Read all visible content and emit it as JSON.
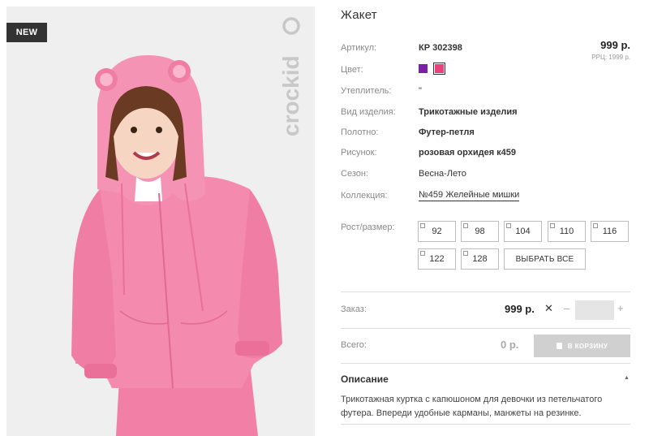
{
  "badge": "NEW",
  "brand": "crockid",
  "product": {
    "title": "Жакет",
    "price": "999 р.",
    "rrc": "РРЦ: 1999 р."
  },
  "details": [
    {
      "label": "Артикул:",
      "value": "КР 302398"
    },
    {
      "label": "Цвет:",
      "value": ""
    },
    {
      "label": "Утеплитель:",
      "value": "\""
    },
    {
      "label": "Вид изделия:",
      "value": "Трикотажные изделия"
    },
    {
      "label": "Полотно:",
      "value": "Футер-петля"
    },
    {
      "label": "Рисунок:",
      "value": "розовая орхидея к459"
    },
    {
      "label": "Сезон:",
      "value": "Весна-Лето"
    },
    {
      "label": "Коллекция:",
      "value": "№459 Желейные мишки"
    }
  ],
  "colors": [
    {
      "name": "purple",
      "hex": "#7a1fa6"
    },
    {
      "name": "pink",
      "hex": "#ec3f7c",
      "selected": true
    }
  ],
  "sizes": {
    "label": "Рост/размер:",
    "items": [
      "92",
      "98",
      "104",
      "110",
      "116",
      "122",
      "128"
    ],
    "select_all": "ВЫБРАТЬ ВСЕ"
  },
  "order": {
    "label": "Заказ:",
    "price": "999 р.",
    "times": "✕",
    "minus": "–",
    "plus": "+",
    "qty": ""
  },
  "total": {
    "label": "Всего:",
    "value": "0 р.",
    "cart_button": "В КОРЗИНУ"
  },
  "description": {
    "title": "Описание",
    "toggle": "▲",
    "text": "Трикотажная куртка с капюшоном для девочки из петельчатого футера. Впереди удобные карманы, манжеты на резинке."
  },
  "accent_colors": {
    "pink": "#f07fa8",
    "cart_disabled": "#d0d0d0"
  }
}
